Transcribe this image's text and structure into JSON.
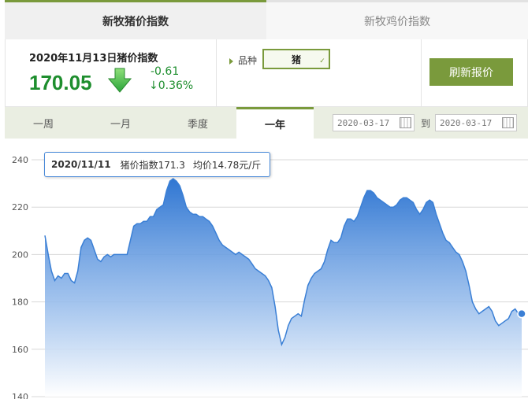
{
  "tabs": [
    {
      "label": "新牧猪价指数",
      "active": true
    },
    {
      "label": "新牧鸡价指数",
      "active": false
    }
  ],
  "summary": {
    "title": "2020年11月13日猪价指数",
    "value": "170.05",
    "change": "-0.61",
    "change_pct": "↓0.36%",
    "trend_icon": "arrow-down-icon"
  },
  "variety": {
    "label": "品种",
    "selected": "猪"
  },
  "refresh_label": "刷新报价",
  "periods": [
    {
      "label": "一周",
      "active": false
    },
    {
      "label": "一月",
      "active": false
    },
    {
      "label": "季度",
      "active": false
    },
    {
      "label": "一年",
      "active": true
    }
  ],
  "date_range": {
    "start": "2020-03-17",
    "to_label": "到",
    "end": "2020-03-17"
  },
  "tooltip": {
    "date": "2020/11/11",
    "index_text": "猪价指数171.3",
    "avg_text": "均价14.78元/斤"
  },
  "colors": {
    "accent": "#7a9a3c",
    "up_down_green": "#1e8e2e",
    "series": "#3a7fd5"
  },
  "chart_data": {
    "type": "area",
    "yticks": [
      140,
      160,
      180,
      200,
      220,
      240
    ],
    "ylim": [
      140,
      240
    ],
    "values": [
      208,
      200,
      193,
      189,
      191,
      190,
      192,
      192,
      189,
      188,
      193,
      203,
      206,
      207,
      206,
      202,
      198,
      197,
      199,
      200,
      199,
      200,
      200,
      200,
      200,
      200,
      206,
      212,
      213,
      213,
      214,
      214,
      216,
      216,
      219,
      220,
      221,
      227,
      231,
      232,
      231,
      229,
      225,
      220,
      218,
      217,
      217,
      216,
      216,
      215,
      214,
      212,
      209,
      206,
      204,
      203,
      202,
      201,
      200,
      201,
      200,
      199,
      198,
      196,
      194,
      193,
      192,
      191,
      189,
      186,
      178,
      168,
      162,
      165,
      170,
      173,
      174,
      175,
      174,
      181,
      187,
      190,
      192,
      193,
      194,
      197,
      202,
      206,
      205,
      205,
      207,
      212,
      215,
      215,
      214,
      216,
      220,
      224,
      227,
      227,
      226,
      224,
      223,
      222,
      221,
      220,
      220,
      221,
      223,
      224,
      224,
      223,
      222,
      219,
      217,
      219,
      222,
      223,
      222,
      217,
      213,
      209,
      206,
      205,
      203,
      201,
      200,
      197,
      193,
      187,
      180,
      177,
      175,
      176,
      177,
      178,
      176,
      172,
      170,
      171,
      172,
      173,
      176,
      177,
      175,
      175
    ]
  }
}
